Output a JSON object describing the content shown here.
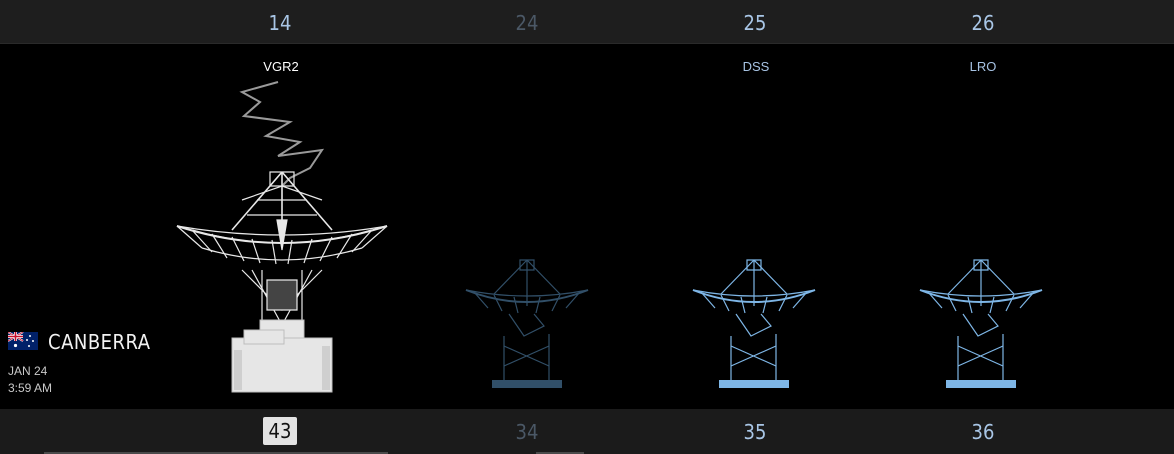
{
  "top_numbers": [
    {
      "value": "14",
      "state": "active"
    },
    {
      "value": "24",
      "state": "dim"
    },
    {
      "value": "25",
      "state": "active"
    },
    {
      "value": "26",
      "state": "active"
    }
  ],
  "bottom_numbers": [
    {
      "value": "43",
      "state": "selected"
    },
    {
      "value": "34",
      "state": "dim"
    },
    {
      "value": "35",
      "state": "active"
    },
    {
      "value": "36",
      "state": "active"
    }
  ],
  "spacecraft_labels": [
    "VGR2",
    "",
    "DSS",
    "LRO"
  ],
  "station": {
    "flag_icon": "australia-flag-icon",
    "name": "CANBERRA",
    "date": "JAN 24",
    "time": "3:59 AM"
  },
  "colors": {
    "active": "#a9c6e6",
    "dim": "#4b5866",
    "dish_white": "#e8e8e8",
    "dish_blue": "#7eb6e6",
    "dish_dim": "#4c7aa0"
  }
}
